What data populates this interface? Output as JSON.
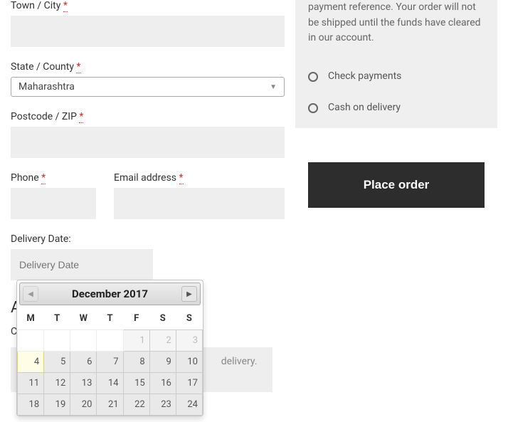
{
  "fields": {
    "town_label": "Town / City",
    "state_label": "State / County",
    "state_value": "Maharashtra",
    "postcode_label": "Postcode / ZIP",
    "phone_label": "Phone",
    "email_label": "Email address",
    "delivery_label": "Delivery Date:",
    "delivery_placeholder": "Delivery Date",
    "required_mark": "*"
  },
  "notes_placeholder_tail": "delivery.",
  "payment": {
    "desc": "payment reference. Your order will not be shipped until the funds have cleared in our account.",
    "options": [
      "Check payments",
      "Cash on delivery"
    ]
  },
  "place_order_label": "Place order",
  "datepicker": {
    "title": "December 2017",
    "dow": [
      "M",
      "T",
      "W",
      "T",
      "F",
      "S",
      "S"
    ],
    "rows": [
      [
        {
          "v": "",
          "c": "empty"
        },
        {
          "v": "",
          "c": "empty"
        },
        {
          "v": "",
          "c": "empty"
        },
        {
          "v": "",
          "c": "empty"
        },
        {
          "v": "1",
          "c": "dim"
        },
        {
          "v": "2",
          "c": "dim"
        },
        {
          "v": "3",
          "c": "dim"
        }
      ],
      [
        {
          "v": "4",
          "c": "today"
        },
        {
          "v": "5",
          "c": ""
        },
        {
          "v": "6",
          "c": ""
        },
        {
          "v": "7",
          "c": ""
        },
        {
          "v": "8",
          "c": ""
        },
        {
          "v": "9",
          "c": ""
        },
        {
          "v": "10",
          "c": ""
        }
      ],
      [
        {
          "v": "11",
          "c": ""
        },
        {
          "v": "12",
          "c": ""
        },
        {
          "v": "13",
          "c": ""
        },
        {
          "v": "14",
          "c": ""
        },
        {
          "v": "15",
          "c": ""
        },
        {
          "v": "16",
          "c": ""
        },
        {
          "v": "17",
          "c": ""
        }
      ],
      [
        {
          "v": "18",
          "c": ""
        },
        {
          "v": "19",
          "c": ""
        },
        {
          "v": "20",
          "c": ""
        },
        {
          "v": "21",
          "c": ""
        },
        {
          "v": "22",
          "c": ""
        },
        {
          "v": "23",
          "c": ""
        },
        {
          "v": "24",
          "c": ""
        }
      ]
    ]
  }
}
